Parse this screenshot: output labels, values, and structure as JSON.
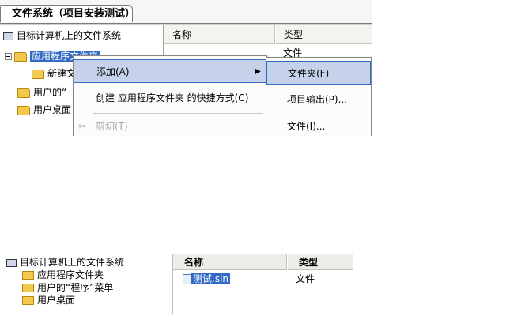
{
  "top": {
    "tab_label": "文件系统（项目安装测试）",
    "tree": {
      "root": "目标计算机上的文件系统",
      "app_folder": "应用程序文件夹",
      "new_item": "新建文",
      "user_programs": "用户的“",
      "user_desktop": "用户桌面"
    },
    "list": {
      "col_name": "名称",
      "col_type": "类型",
      "partial_type": "文件"
    },
    "context_menu": {
      "add": "添加(A)",
      "create_shortcut": "创建 应用程序文件夹 的快捷方式(C)",
      "cut": "剪切(T)"
    },
    "submenu": {
      "folder": "文件夹(F)",
      "project_output": "项目输出(P)...",
      "file": "文件(I)..."
    }
  },
  "bottom": {
    "tree": {
      "root": "目标计算机上的文件系统",
      "app_folder": "应用程序文件夹",
      "user_programs": "用户的“程序”菜单",
      "user_desktop": "用户桌面"
    },
    "list": {
      "col_name": "名称",
      "col_type": "类型",
      "rows": [
        {
          "name": "测试.sln",
          "type": "文件"
        }
      ]
    }
  },
  "colors": {
    "selection": "#316ac5",
    "menu_highlight": "#c6d2ea",
    "folder": "#f2c94c"
  }
}
